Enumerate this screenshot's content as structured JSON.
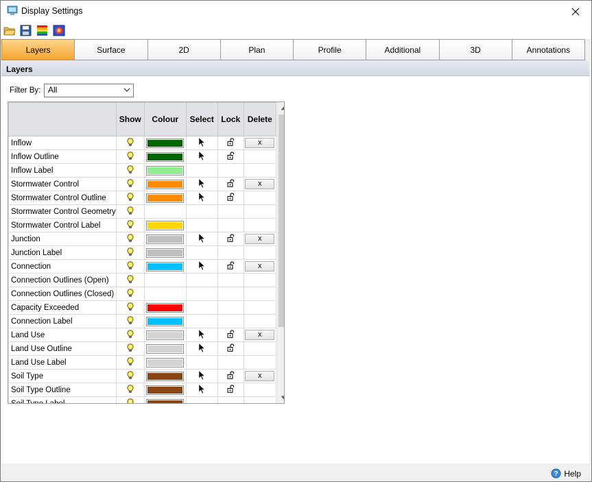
{
  "window": {
    "title": "Display Settings"
  },
  "toolbar": {
    "icons": [
      "open-folder-icon",
      "save-icon",
      "colour-palette-icon",
      "theme-icon"
    ]
  },
  "tabs": [
    "Layers",
    "Surface",
    "2D",
    "Plan",
    "Profile",
    "Additional",
    "3D",
    "Annotations"
  ],
  "active_tab": "Layers",
  "section": {
    "title": "Layers"
  },
  "filter": {
    "label": "Filter By:",
    "value": "All"
  },
  "grid": {
    "columns": [
      "",
      "Show",
      "Colour",
      "Select",
      "Lock",
      "Delete"
    ],
    "delete_label": "x",
    "rows": [
      {
        "name": "Inflow",
        "colour": "#006400",
        "select": true,
        "lock": true,
        "delete": true
      },
      {
        "name": "Inflow Outline",
        "colour": "#006400",
        "select": true,
        "lock": true,
        "delete": false
      },
      {
        "name": "Inflow Label",
        "colour": "#90ee90",
        "select": false,
        "lock": false,
        "delete": false
      },
      {
        "name": "Stormwater Control",
        "colour": "#ff8c00",
        "select": true,
        "lock": true,
        "delete": true
      },
      {
        "name": "Stormwater Control Outline",
        "colour": "#ff8c00",
        "select": true,
        "lock": true,
        "delete": false
      },
      {
        "name": "Stormwater Control Geometry",
        "colour": null,
        "select": false,
        "lock": false,
        "delete": false
      },
      {
        "name": "Stormwater Control Label",
        "colour": "#ffd700",
        "select": false,
        "lock": false,
        "delete": false
      },
      {
        "name": "Junction",
        "colour": "#c0c0c0",
        "select": true,
        "lock": true,
        "delete": true
      },
      {
        "name": "Junction Label",
        "colour": "#c0c0c0",
        "select": false,
        "lock": false,
        "delete": false
      },
      {
        "name": "Connection",
        "colour": "#00bfff",
        "select": true,
        "lock": true,
        "delete": true
      },
      {
        "name": "Connection Outlines (Open)",
        "colour": null,
        "select": false,
        "lock": false,
        "delete": false
      },
      {
        "name": "Connection Outlines (Closed)",
        "colour": null,
        "select": false,
        "lock": false,
        "delete": false
      },
      {
        "name": "Capacity Exceeded",
        "colour": "#ff0000",
        "select": false,
        "lock": false,
        "delete": false
      },
      {
        "name": "Connection Label",
        "colour": "#00bfff",
        "select": false,
        "lock": false,
        "delete": false
      },
      {
        "name": "Land Use",
        "colour": "#d3d3d3",
        "select": true,
        "lock": true,
        "delete": true
      },
      {
        "name": "Land Use Outline",
        "colour": "#d3d3d3",
        "select": true,
        "lock": true,
        "delete": false
      },
      {
        "name": "Land Use Label",
        "colour": "#d3d3d3",
        "select": false,
        "lock": false,
        "delete": false
      },
      {
        "name": "Soil Type",
        "colour": "#8b4513",
        "select": true,
        "lock": true,
        "delete": true
      },
      {
        "name": "Soil Type Outline",
        "colour": "#8b4513",
        "select": true,
        "lock": true,
        "delete": false
      },
      {
        "name": "Soil Type Label",
        "colour": "#8b4513",
        "select": false,
        "lock": false,
        "delete": false
      }
    ]
  },
  "status": {
    "help_label": "Help"
  }
}
